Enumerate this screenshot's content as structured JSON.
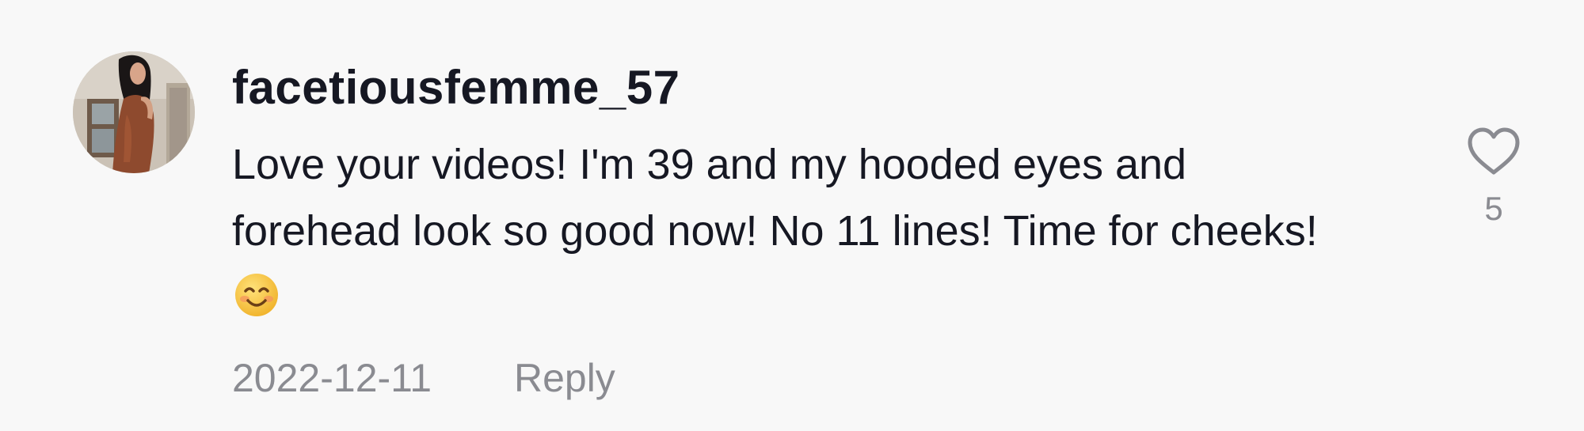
{
  "comment": {
    "username": "facetiousfemme_57",
    "text": "Love your videos! I'm 39 and my hooded eyes and forehead look so good now! No 11 lines! Time for cheeks!",
    "emoji": "smiling-face-emoji",
    "date": "2022-12-11",
    "reply_label": "Reply",
    "like_count": "5",
    "avatar": "user-avatar-photo"
  },
  "icons": {
    "like": "heart-outline-icon"
  },
  "colors": {
    "background": "#f8f8f8",
    "text_primary": "#161823",
    "text_secondary": "#8a8b91",
    "emoji_face": "#f7c23b"
  }
}
